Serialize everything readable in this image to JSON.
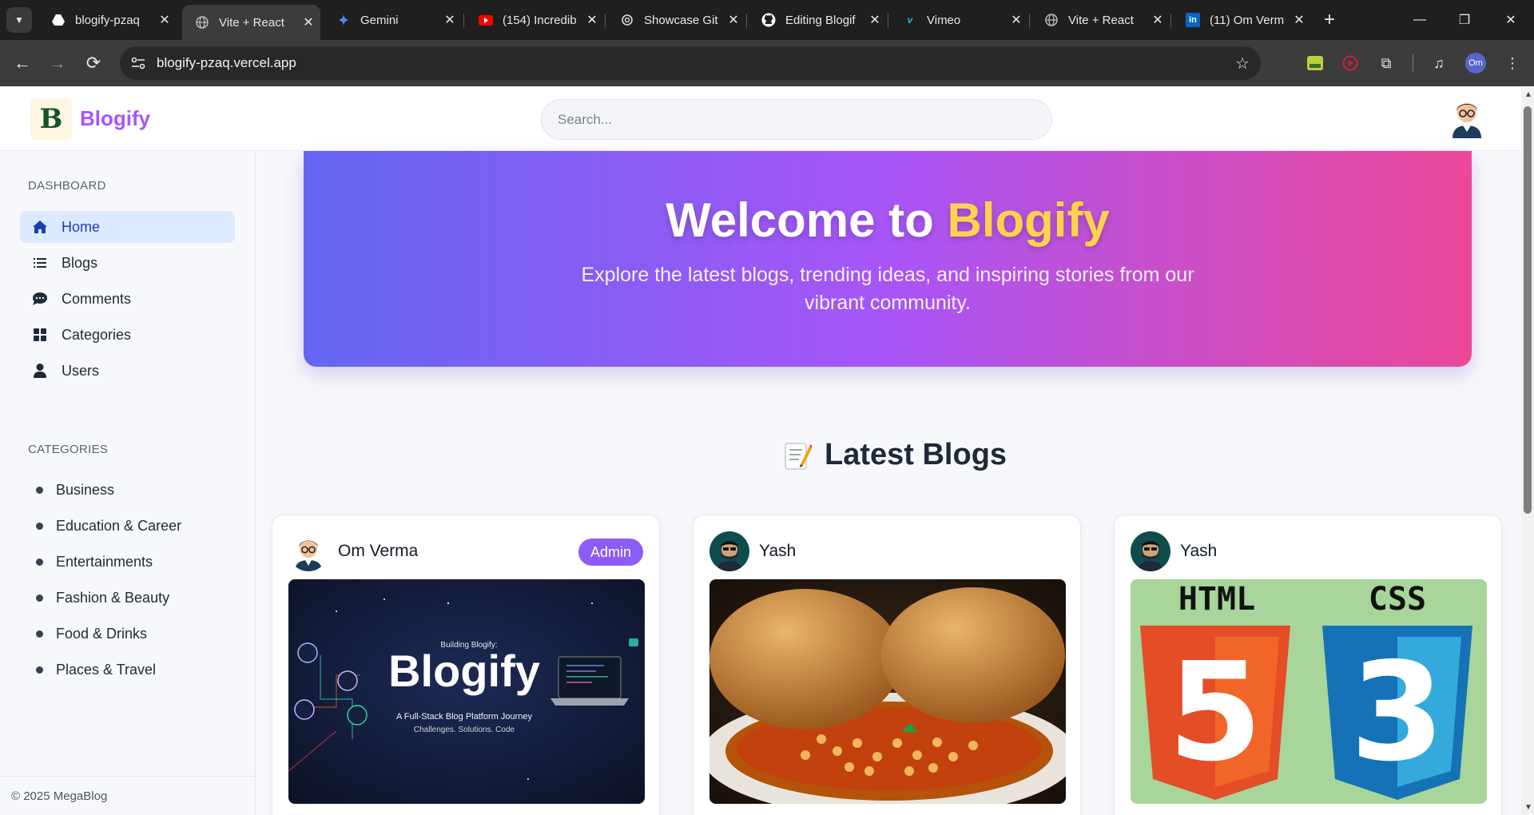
{
  "browser": {
    "tabs": [
      {
        "title": "blogify-pzaq",
        "icon": "drive-icon"
      },
      {
        "title": "Vite + React",
        "icon": "globe-icon",
        "active": true
      },
      {
        "title": "Gemini",
        "icon": "gemini-icon"
      },
      {
        "title": "(154) Incredib",
        "icon": "youtube-icon"
      },
      {
        "title": "Showcase Git",
        "icon": "chatgpt-icon"
      },
      {
        "title": "Editing Blogif",
        "icon": "github-icon"
      },
      {
        "title": "Vimeo",
        "icon": "vimeo-icon"
      },
      {
        "title": "Vite + React",
        "icon": "globe-icon"
      },
      {
        "title": "(11) Om Verm",
        "icon": "linkedin-icon"
      }
    ],
    "url": "blogify-pzaq.vercel.app",
    "profile_initials": "Om"
  },
  "header": {
    "logo_letter": "B",
    "brand": "Blogify",
    "search_placeholder": "Search..."
  },
  "sidebar": {
    "dashboard_heading": "DASHBOARD",
    "nav": [
      {
        "label": "Home",
        "icon": "home-icon",
        "active": true
      },
      {
        "label": "Blogs",
        "icon": "list-icon"
      },
      {
        "label": "Comments",
        "icon": "comment-icon"
      },
      {
        "label": "Categories",
        "icon": "grid-icon"
      },
      {
        "label": "Users",
        "icon": "user-icon"
      }
    ],
    "categories_heading": "CATEGORIES",
    "categories": [
      "Business",
      "Education & Career",
      "Entertainments",
      "Fashion & Beauty",
      "Food & Drinks",
      "Places & Travel"
    ],
    "footer": "© 2025 MegaBlog"
  },
  "hero": {
    "title_prefix": "Welcome to ",
    "title_highlight": "Blogify",
    "subtitle": "Explore the latest blogs, trending ideas, and inspiring stories from our vibrant community."
  },
  "latest": {
    "title": "Latest Blogs",
    "cards": [
      {
        "author": "Om Verma",
        "badge": "Admin",
        "thumb": {
          "kicker": "Building Blogify:",
          "title": "Blogify",
          "line1": "A Full-Stack Blog Platform Journey",
          "line2": "Challenges. Solutions. Code"
        }
      },
      {
        "author": "Yash"
      },
      {
        "author": "Yash",
        "thumb": {
          "left": "HTML",
          "right": "CSS",
          "left_num": "5",
          "right_num": "3"
        }
      }
    ]
  },
  "colors": {
    "brand": "#a855f7",
    "hero_start": "#6366f1",
    "hero_mid": "#a855f7",
    "hero_end": "#ec4899",
    "highlight": "#fcd34d",
    "badge": "#8b5cf6",
    "active_nav_bg": "#dbeafe"
  }
}
